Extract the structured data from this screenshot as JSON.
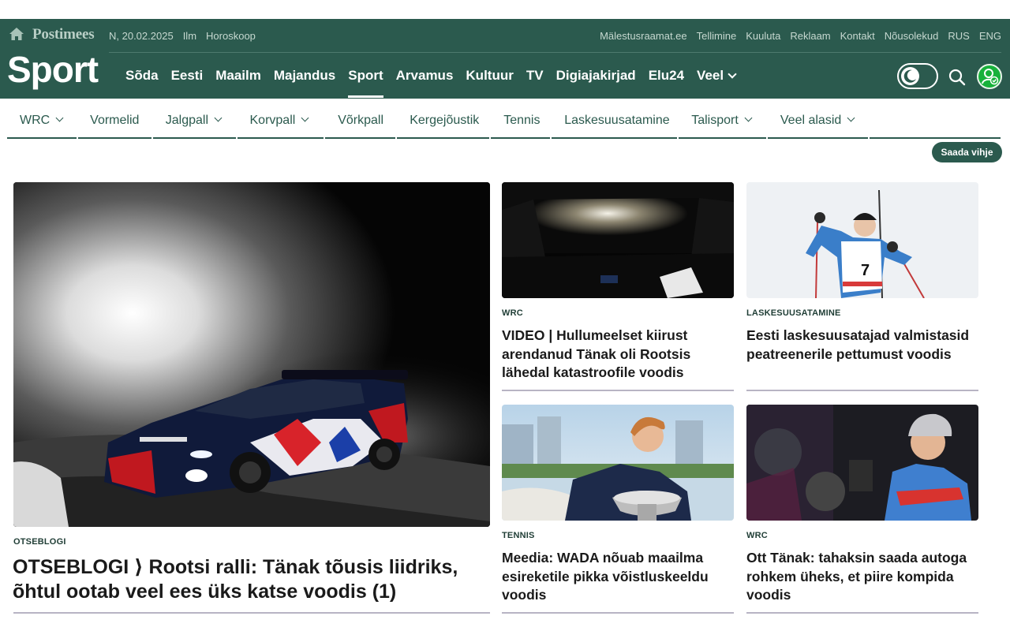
{
  "header": {
    "brand": "Postimees",
    "date": "N, 20.02.2025",
    "weather": "Ilm",
    "horoscope": "Horoskoop",
    "utility_links": [
      "Mälestusraamat.ee",
      "Tellimine",
      "Kuuluta",
      "Reklaam",
      "Kontakt",
      "Nõusolekud",
      "RUS",
      "ENG"
    ],
    "section_title": "Sport",
    "nav": [
      "Sõda",
      "Eesti",
      "Maailm",
      "Majandus",
      "Sport",
      "Arvamus",
      "Kultuur",
      "TV",
      "Digiajakirjad",
      "Elu24",
      "Veel"
    ],
    "active_nav": "Sport",
    "colors": {
      "header_bg": "#2b5a4e",
      "user_icon": "#18b13b"
    }
  },
  "subnav": [
    "WRC",
    "Vormelid",
    "Jalgpall",
    "Korvpall",
    "Võrkpall",
    "Kergejõustik",
    "Tennis",
    "Laskesuusatamine",
    "Talisport",
    "Veel alasid"
  ],
  "tip_button": "Saada vihje",
  "articles": [
    {
      "category": "OTSEBLOGI",
      "title": "OTSEBLOGI ⟩ Rootsi ralli: Tänak tõusis liidriks, õhtul ootab veel ees üks katse voodis (1)",
      "image": "rally-car-night-snow"
    },
    {
      "category": "WRC",
      "title": "VIDEO | Hullumeelset kiirust arendanud Tänak oli Rootsis lähedal katastroofile voodis",
      "image": "in-car-night-view"
    },
    {
      "category": "LASKESUUSATAMINE",
      "title": "Eesti laskesuusatajad valmistasid peatreenerile pettumust voodis",
      "image": "biathlete-number-7"
    },
    {
      "category": "TENNIS",
      "title": "Meedia: WADA nõuab maailma esireketile pikka võistluskeeldu voodis",
      "image": "tennis-player-trophy"
    },
    {
      "category": "WRC",
      "title": "Ott Tänak: tahaksin saada autoga rohkem üheks, et piire kompida voodis",
      "image": "driver-in-cap"
    }
  ]
}
